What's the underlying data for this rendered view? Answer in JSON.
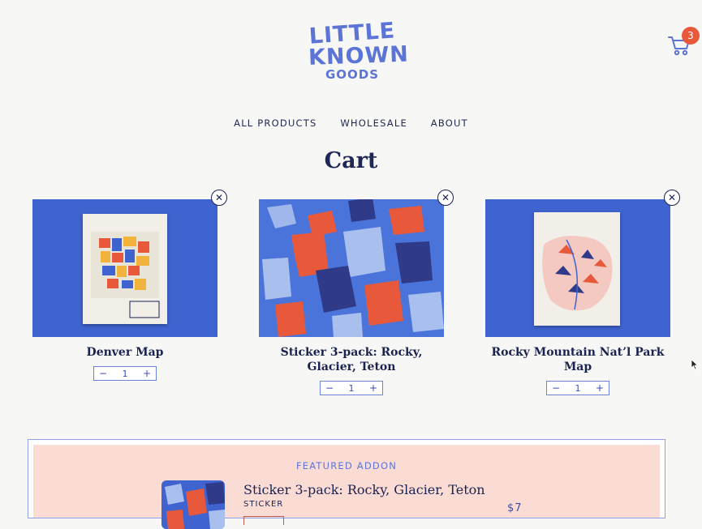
{
  "brand": {
    "line1": "LITTLE",
    "line2": "KNOWN",
    "line3": "GOODS",
    "color": "#5c74d6"
  },
  "header": {
    "cart_count": "3"
  },
  "nav": {
    "items": [
      "ALL PRODUCTS",
      "WHOLESALE",
      "ABOUT"
    ]
  },
  "page_title": "Cart",
  "cart": {
    "items": [
      {
        "name": "Denver Map",
        "quantity": "1",
        "decrement": "−",
        "increment": "+",
        "remove": "✕"
      },
      {
        "name": "Sticker 3-pack: Rocky, Glacier, Teton",
        "quantity": "1",
        "decrement": "−",
        "increment": "+",
        "remove": "✕"
      },
      {
        "name": "Rocky Mountain Nat’l Park Map",
        "quantity": "1",
        "decrement": "−",
        "increment": "+",
        "remove": "✕"
      }
    ]
  },
  "addon": {
    "label": "FEATURED ADDON",
    "name": "Sticker 3-pack: Rocky, Glacier, Teton",
    "category": "STICKER",
    "price": "$7"
  },
  "colors": {
    "accent": "#5c74d6",
    "navy": "#1a2250",
    "badge": "#e8593c",
    "addon_bg": "#fbdcd4",
    "product_bg": "#3f63cf"
  }
}
